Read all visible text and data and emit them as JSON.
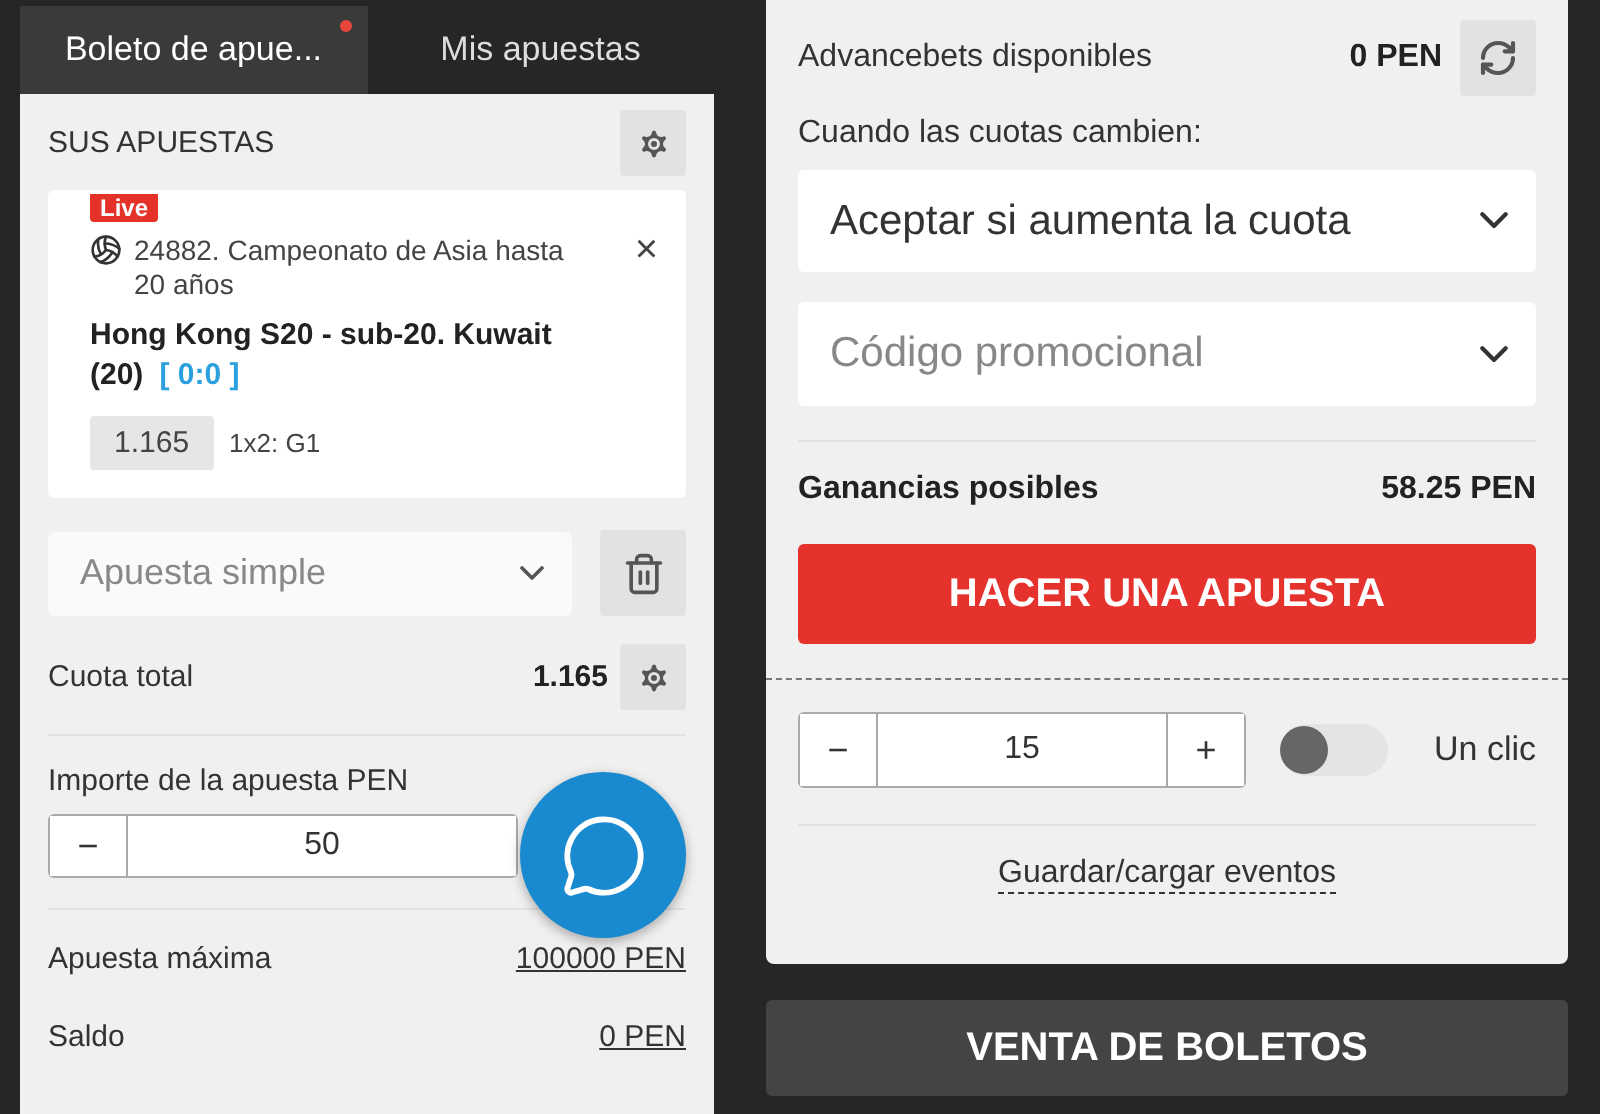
{
  "tabs": [
    {
      "label": "Boleto de apue...",
      "selected": true,
      "dot": true
    },
    {
      "label": "Mis apuestas",
      "selected": false,
      "dot": false
    }
  ],
  "slip": {
    "title": "SUS APUESTAS",
    "bet": {
      "badge": "Live",
      "event": "24882. Campeonato de Asia hasta 20 años",
      "match": "Hong Kong S20 - sub-20. Kuwait (20)",
      "score": "[ 0:0 ]",
      "odds": "1.165",
      "market": "1x2: G1",
      "close": "×"
    },
    "bet_type": {
      "value": "Apuesta simple"
    },
    "total": {
      "label": "Cuota total",
      "value": "1.165"
    },
    "stake": {
      "label": "Importe de la apuesta PEN",
      "minus": "−",
      "value": "50"
    },
    "rows": [
      {
        "label": "Apuesta máxima",
        "value": "100000 PEN"
      },
      {
        "label": "Saldo",
        "value": "0 PEN"
      }
    ]
  },
  "options": {
    "advancebets": {
      "label": "Advancebets disponibles",
      "value": "0 PEN"
    },
    "odds_change": {
      "label": "Cuando las cuotas cambien:",
      "value": "Aceptar si aumenta la cuota"
    },
    "promo": {
      "placeholder": "Código promocional"
    },
    "winnings": {
      "label": "Ganancias posibles",
      "value": "58.25 PEN"
    },
    "place_button": "HACER UNA APUESTA",
    "quick": {
      "minus": "−",
      "value": "15",
      "plus": "+",
      "toggle_on": false,
      "toggle_label": "Un clic"
    },
    "save_link": "Guardar/cargar eventos"
  },
  "sell_button": "VENTA DE BOLETOS"
}
